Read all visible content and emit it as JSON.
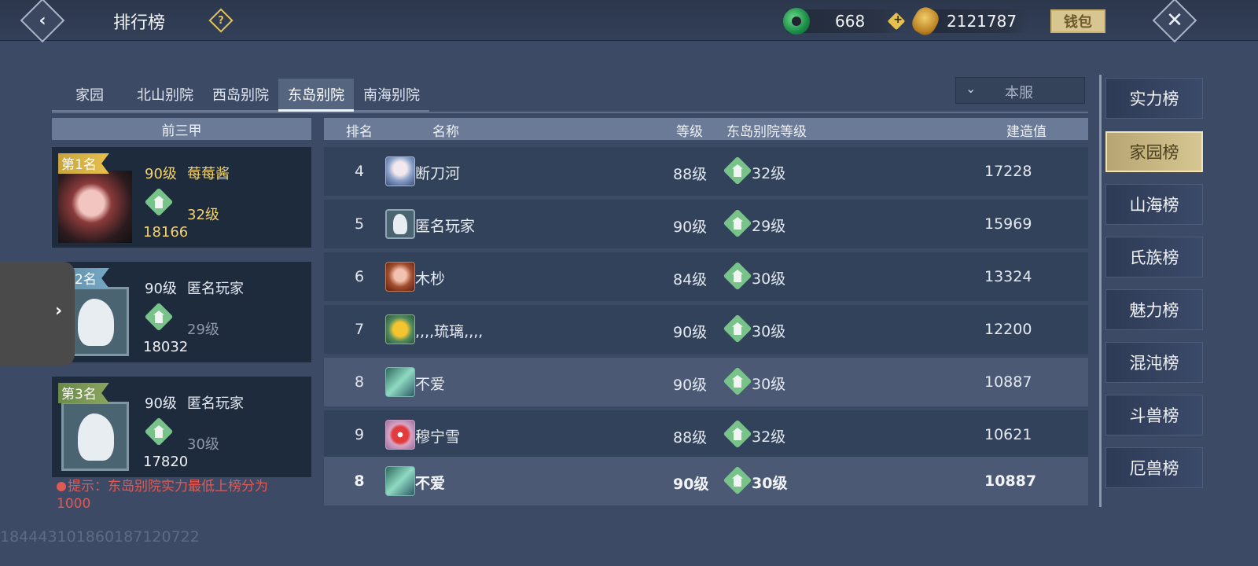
{
  "header": {
    "title": "排行榜",
    "help_label": "?",
    "jade_amount": "668",
    "gold_amount": "2121787",
    "wallet_label": "钱包"
  },
  "tabs": [
    {
      "label": "家园"
    },
    {
      "label": "北山别院"
    },
    {
      "label": "西岛别院"
    },
    {
      "label": "东岛别院",
      "active": true
    },
    {
      "label": "南海别院"
    }
  ],
  "server_filter": {
    "value": "本服"
  },
  "top3": {
    "heading": "前三甲",
    "entries": [
      {
        "badge": "第1名",
        "level": "90级",
        "name": "莓莓酱",
        "house_level": "32级",
        "score": "18166"
      },
      {
        "badge": "第2名",
        "level": "90级",
        "name": "匿名玩家",
        "house_level": "29级",
        "score": "18032"
      },
      {
        "badge": "第3名",
        "level": "90级",
        "name": "匿名玩家",
        "house_level": "30级",
        "score": "17820"
      }
    ]
  },
  "hint": "提示：东岛别院实力最低上榜分为1000",
  "uid": "1844431018601871207‌22",
  "table": {
    "headers": {
      "rank": "排名",
      "name": "名称",
      "level": "等级",
      "house_level": "东岛别院等级",
      "score": "建造值"
    },
    "rows": [
      {
        "rank": "4",
        "name": "断刀河",
        "level": "88级",
        "house_level": "32级",
        "score": "17228"
      },
      {
        "rank": "5",
        "name": "匿名玩家",
        "level": "90级",
        "house_level": "29级",
        "score": "15969"
      },
      {
        "rank": "6",
        "name": "木杪",
        "level": "84级",
        "house_level": "30级",
        "score": "13324"
      },
      {
        "rank": "7",
        "name": ",,,,琉璃,,,,",
        "level": "90级",
        "house_level": "30级",
        "score": "12200"
      },
      {
        "rank": "8",
        "name": "不爱",
        "level": "90级",
        "house_level": "30级",
        "score": "10887"
      },
      {
        "rank": "9",
        "name": "穆宁雪",
        "level": "88级",
        "house_level": "32级",
        "score": "10621"
      }
    ],
    "self_row": {
      "rank": "8",
      "name": "不爱",
      "level": "90级",
      "house_level": "30级",
      "score": "10887"
    }
  },
  "categories": [
    {
      "label": "实力榜"
    },
    {
      "label": "家园榜",
      "active": true
    },
    {
      "label": "山海榜"
    },
    {
      "label": "氏族榜"
    },
    {
      "label": "魅力榜"
    },
    {
      "label": "混沌榜"
    },
    {
      "label": "斗兽榜"
    },
    {
      "label": "厄兽榜"
    }
  ]
}
